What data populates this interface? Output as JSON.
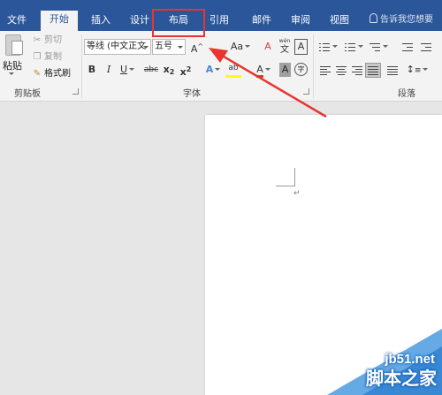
{
  "tabs": [
    {
      "label": "文件"
    },
    {
      "label": "开始"
    },
    {
      "label": "插入"
    },
    {
      "label": "设计"
    },
    {
      "label": "布局"
    },
    {
      "label": "引用"
    },
    {
      "label": "邮件"
    },
    {
      "label": "审阅"
    },
    {
      "label": "视图"
    }
  ],
  "tell_me": "告诉我您想要",
  "clipboard": {
    "paste": "粘贴",
    "cut": "剪切",
    "copy": "复制",
    "format_painter": "格式刷",
    "group_label": "剪贴板"
  },
  "font": {
    "font_name": "等线 (中文正文",
    "font_size": "五号",
    "grow": "A",
    "change_case": "Aa",
    "clear_format": "A",
    "phonetic_top": "wén",
    "phonetic_char": "文",
    "char_border": "A",
    "bold": "B",
    "italic": "I",
    "underline": "U",
    "strikethrough": "abc",
    "subscript_base": "x",
    "subscript_mark": "2",
    "superscript_base": "x",
    "superscript_mark": "2",
    "text_effects": "A",
    "highlight": "ab",
    "font_color": "A",
    "char_shading": "A",
    "enclose_char": "字",
    "group_label": "字体"
  },
  "paragraph": {
    "group_label": "段落"
  },
  "colors": {
    "accent": "#2b579a",
    "annotation": "#e8352e",
    "highlight_yellow": "#ffff00",
    "font_red": "#e8352e"
  },
  "document": {
    "paragraph_mark": "↵"
  },
  "watermark": {
    "url": "jb51.net",
    "name": "脚本之家"
  }
}
